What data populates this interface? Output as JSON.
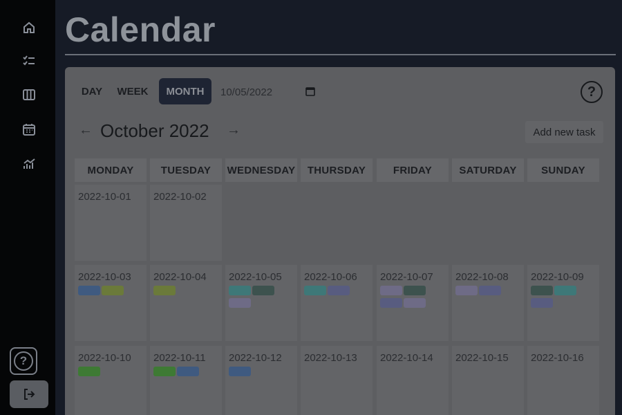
{
  "app": {
    "title": "Calendar"
  },
  "sidebar": {
    "items": [
      {
        "name": "home-icon",
        "label": "Home"
      },
      {
        "name": "tasks-icon",
        "label": "Tasks"
      },
      {
        "name": "board-icon",
        "label": "Board"
      },
      {
        "name": "calendar-icon",
        "label": "Calendar"
      },
      {
        "name": "analytics-icon",
        "label": "Analytics"
      }
    ],
    "help_glyph": "?",
    "logout_icon": "logout-icon"
  },
  "toolbar": {
    "views": [
      "DAY",
      "WEEK",
      "MONTH"
    ],
    "active_view": "MONTH",
    "date_value": "10/05/2022",
    "help_glyph": "?"
  },
  "header": {
    "prev_glyph": "←",
    "next_glyph": "→",
    "month_label": "October 2022",
    "add_task_label": "Add new task"
  },
  "weekdays": [
    "MONDAY",
    "TUESDAY",
    "WEDNESDAY",
    "THURSDAY",
    "FRIDAY",
    "SATURDAY",
    "SUNDAY"
  ],
  "task_colors": {
    "blue": "#3f5a80",
    "olive": "#6b7a3a",
    "teal": "#3e7878",
    "dark_teal": "#3d524e",
    "lavender": "#6e6b86",
    "purple": "#585c80",
    "green": "#3e7a34"
  },
  "weeks": [
    [
      {
        "date": "2022-10-01",
        "tasks": []
      },
      {
        "date": "2022-10-02",
        "tasks": []
      }
    ],
    [
      {
        "date": "2022-10-03",
        "tasks": [
          "blue",
          "olive"
        ]
      },
      {
        "date": "2022-10-04",
        "tasks": [
          "olive"
        ]
      },
      {
        "date": "2022-10-05",
        "tasks": [
          "teal",
          "dark_teal",
          "lavender"
        ]
      },
      {
        "date": "2022-10-06",
        "tasks": [
          "teal",
          "purple"
        ]
      },
      {
        "date": "2022-10-07",
        "tasks": [
          "lavender",
          "dark_teal",
          "purple",
          "lavender"
        ]
      },
      {
        "date": "2022-10-08",
        "tasks": [
          "lavender",
          "purple"
        ]
      },
      {
        "date": "2022-10-09",
        "tasks": [
          "dark_teal",
          "teal",
          "purple"
        ]
      }
    ],
    [
      {
        "date": "2022-10-10",
        "tasks": [
          "green"
        ]
      },
      {
        "date": "2022-10-11",
        "tasks": [
          "green",
          "blue"
        ]
      },
      {
        "date": "2022-10-12",
        "tasks": [
          "blue"
        ]
      },
      {
        "date": "2022-10-13",
        "tasks": []
      },
      {
        "date": "2022-10-14",
        "tasks": []
      },
      {
        "date": "2022-10-15",
        "tasks": []
      },
      {
        "date": "2022-10-16",
        "tasks": []
      }
    ]
  ]
}
